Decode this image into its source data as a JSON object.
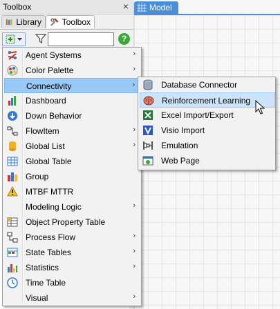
{
  "toolbox_panel": {
    "title": "Toolbox",
    "close_glyph": "×",
    "tabs": [
      {
        "label": "Library",
        "icon": "library-icon",
        "active": false
      },
      {
        "label": "Toolbox",
        "icon": "toolbox-icon",
        "active": true
      }
    ],
    "search": {
      "value": "",
      "placeholder": ""
    },
    "help_glyph": "?"
  },
  "model_tab": {
    "label": "Model",
    "icon": "grid-icon",
    "color": "#4d8fd6"
  },
  "context_menu": {
    "items": [
      {
        "label": "Agent Systems",
        "icon": "agent-systems-icon",
        "submenu": true
      },
      {
        "label": "Color Palette",
        "icon": "color-palette-icon",
        "submenu": true
      },
      {
        "label": "Connectivity",
        "icon": "",
        "submenu": true,
        "highlighted": true
      },
      {
        "label": "Dashboard",
        "icon": "dashboard-icon",
        "submenu": false
      },
      {
        "label": "Down Behavior",
        "icon": "down-behavior-icon",
        "submenu": false
      },
      {
        "label": "FlowItem",
        "icon": "flowitem-icon",
        "submenu": true
      },
      {
        "label": "Global List",
        "icon": "global-list-icon",
        "submenu": true
      },
      {
        "label": "Global Table",
        "icon": "global-table-icon",
        "submenu": false
      },
      {
        "label": "Group",
        "icon": "group-icon",
        "submenu": false
      },
      {
        "label": "MTBF MTTR",
        "icon": "mtbf-mttr-icon",
        "submenu": false
      },
      {
        "label": "Modeling Logic",
        "icon": "",
        "submenu": true
      },
      {
        "label": "Object Property Table",
        "icon": "object-property-table-icon",
        "submenu": false
      },
      {
        "label": "Process Flow",
        "icon": "process-flow-icon",
        "submenu": true
      },
      {
        "label": "State Tables",
        "icon": "state-tables-icon",
        "submenu": true
      },
      {
        "label": "Statistics",
        "icon": "statistics-icon",
        "submenu": true
      },
      {
        "label": "Time Table",
        "icon": "time-table-icon",
        "submenu": false
      },
      {
        "label": "Visual",
        "icon": "",
        "submenu": true
      }
    ],
    "arrow_glyph": "›"
  },
  "connectivity_submenu": {
    "items": [
      {
        "label": "Database Connector",
        "icon": "database-icon"
      },
      {
        "label": "Reinforcement Learning",
        "icon": "brain-icon",
        "highlighted": true
      },
      {
        "label": "Excel Import/Export",
        "icon": "excel-icon"
      },
      {
        "label": "Visio Import",
        "icon": "visio-icon"
      },
      {
        "label": "Emulation",
        "icon": "emulation-icon"
      },
      {
        "label": "Web Page",
        "icon": "web-page-icon"
      }
    ]
  },
  "colors": {
    "highlight": "#99c9f7",
    "hover": "#cce4f9",
    "help_green": "#3aa83a"
  }
}
